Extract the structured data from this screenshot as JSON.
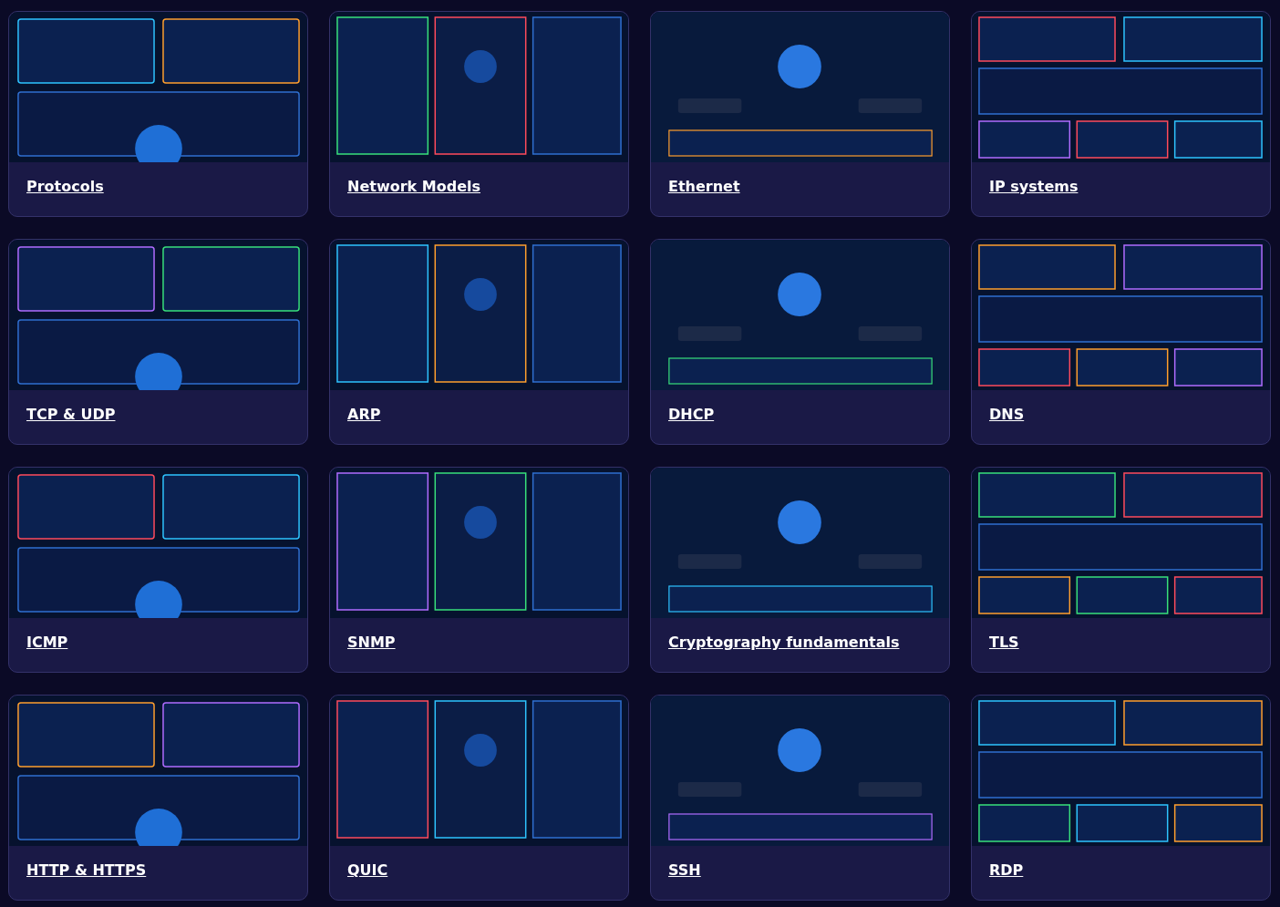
{
  "cards": [
    {
      "title": "Protocols"
    },
    {
      "title": "Network Models"
    },
    {
      "title": "Ethernet"
    },
    {
      "title": "IP systems"
    },
    {
      "title": "TCP & UDP"
    },
    {
      "title": "ARP"
    },
    {
      "title": "DHCP"
    },
    {
      "title": "DNS"
    },
    {
      "title": "ICMP"
    },
    {
      "title": "SNMP"
    },
    {
      "title": "Cryptography fundamentals"
    },
    {
      "title": "TLS"
    },
    {
      "title": "HTTP & HTTPS"
    },
    {
      "title": "QUIC"
    },
    {
      "title": "SSH"
    },
    {
      "title": "RDP"
    }
  ]
}
